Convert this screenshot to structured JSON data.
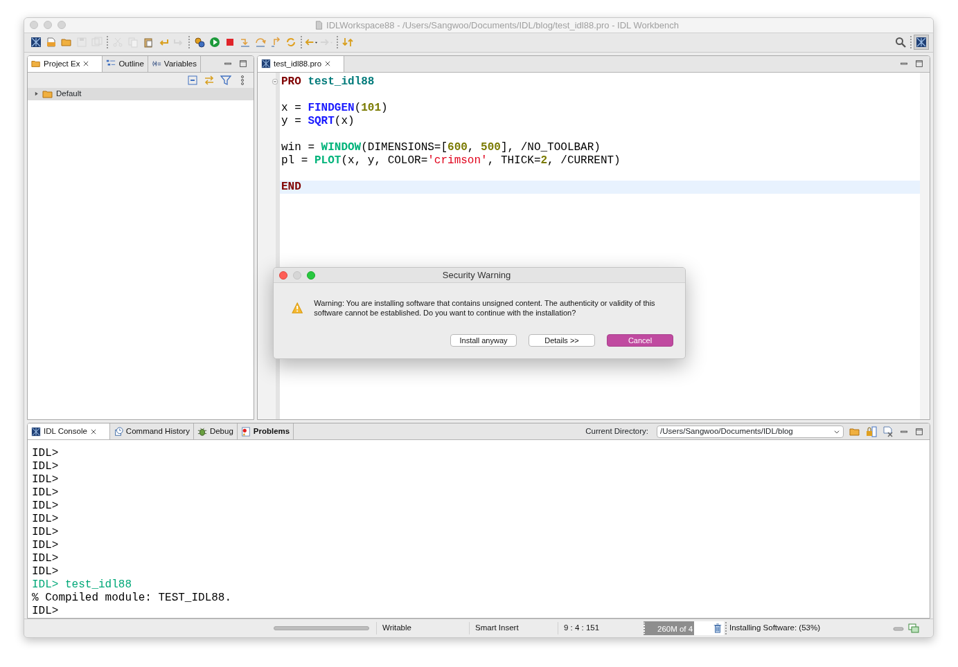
{
  "window": {
    "title": "IDLWorkspace88 - /Users/Sangwoo/Documents/IDL/blog/test_idl88.pro - IDL Workbench"
  },
  "toolbar": [
    {
      "kind": "idl",
      "disabled": false
    },
    {
      "kind": "new",
      "disabled": false
    },
    {
      "kind": "open",
      "disabled": false
    },
    {
      "kind": "save",
      "disabled": true
    },
    {
      "kind": "saveall",
      "disabled": true
    },
    {
      "kind": "separator"
    },
    {
      "kind": "cut",
      "disabled": true
    },
    {
      "kind": "copy",
      "disabled": true
    },
    {
      "kind": "paste",
      "disabled": false
    },
    {
      "kind": "undo",
      "disabled": false
    },
    {
      "kind": "redo",
      "disabled": true
    },
    {
      "kind": "separator"
    },
    {
      "kind": "compile",
      "disabled": false
    },
    {
      "kind": "run",
      "disabled": false
    },
    {
      "kind": "stop",
      "disabled": false
    },
    {
      "kind": "stepinto",
      "disabled": false
    },
    {
      "kind": "stepover",
      "disabled": false
    },
    {
      "kind": "stepreturn",
      "disabled": false
    },
    {
      "kind": "reset",
      "disabled": false
    },
    {
      "kind": "separator"
    },
    {
      "kind": "back",
      "disabled": false
    },
    {
      "kind": "forward",
      "disabled": true
    },
    {
      "kind": "separator"
    },
    {
      "kind": "annotation",
      "disabled": false
    }
  ],
  "left_panel": {
    "tabs": [
      {
        "label": "Project Ex",
        "selected": true,
        "closable": true
      },
      {
        "label": "Outline",
        "selected": false
      },
      {
        "label": "Variables",
        "selected": false
      }
    ],
    "tree": [
      {
        "label": "Default",
        "expanded": false,
        "selected": true
      }
    ]
  },
  "editor": {
    "tabs": [
      {
        "label": "test_idl88.pro",
        "selected": true,
        "closable": true
      }
    ],
    "lines": [
      {
        "current": false,
        "foldable": true,
        "expanded": true,
        "tokens": [
          {
            "text": "PRO",
            "kind": "keyword"
          },
          {
            "text": " test_idl88",
            "kind": "name"
          }
        ]
      },
      {
        "current": false
      },
      {
        "current": false,
        "tokens": [
          {
            "text": "x = ",
            "kind": "plain"
          },
          {
            "text": "FINDGEN",
            "kind": "function"
          },
          {
            "text": "(",
            "kind": "plain"
          },
          {
            "text": "101",
            "kind": "number"
          },
          {
            "text": ")",
            "kind": "plain"
          }
        ]
      },
      {
        "current": false,
        "tokens": [
          {
            "text": "y = ",
            "kind": "plain"
          },
          {
            "text": "SQRT",
            "kind": "function"
          },
          {
            "text": "(x)",
            "kind": "plain"
          }
        ]
      },
      {
        "current": false
      },
      {
        "current": false,
        "tokens": [
          {
            "text": "win = ",
            "kind": "plain"
          },
          {
            "text": "WINDOW",
            "kind": "graphics"
          },
          {
            "text": "(DIMENSIONS=[",
            "kind": "plain"
          },
          {
            "text": "600",
            "kind": "number"
          },
          {
            "text": ", ",
            "kind": "plain"
          },
          {
            "text": "500",
            "kind": "number"
          },
          {
            "text": "], /NO_TOOLBAR)",
            "kind": "plain"
          }
        ]
      },
      {
        "current": false,
        "tokens": [
          {
            "text": "pl = ",
            "kind": "plain"
          },
          {
            "text": "PLOT",
            "kind": "graphics"
          },
          {
            "text": "(x, y, COLOR=",
            "kind": "plain"
          },
          {
            "text": "'crimson'",
            "kind": "string"
          },
          {
            "text": ", THICK=",
            "kind": "plain"
          },
          {
            "text": "2",
            "kind": "number"
          },
          {
            "text": ", /CURRENT)",
            "kind": "plain"
          }
        ]
      },
      {
        "current": false
      },
      {
        "current": true,
        "tokens": [
          {
            "text": "END",
            "kind": "keyword"
          }
        ]
      }
    ]
  },
  "dialog": {
    "title": "Security Warning",
    "message": "Warning: You are installing software that contains unsigned content. The authenticity or validity of this software cannot be established. Do you want to continue with the installation?",
    "buttons": [
      {
        "label": "Install anyway",
        "default": false
      },
      {
        "label": "Details >>",
        "default": false
      },
      {
        "label": "Cancel",
        "default": true
      }
    ]
  },
  "console": {
    "tabs": [
      {
        "label": "IDL Console",
        "selected": true,
        "closable": true,
        "attention": false
      },
      {
        "label": "Command History",
        "selected": false,
        "attention": false
      },
      {
        "label": "Debug",
        "selected": false,
        "attention": false
      },
      {
        "label": "Problems",
        "selected": false,
        "attention": true
      }
    ],
    "directory_label": "Current Directory:",
    "directory": "/Users/Sangwoo/Documents/IDL/blog",
    "lines": [
      {
        "kind": "prompt",
        "text": "IDL>"
      },
      {
        "kind": "prompt",
        "text": "IDL>"
      },
      {
        "kind": "prompt",
        "text": "IDL>"
      },
      {
        "kind": "prompt",
        "text": "IDL>"
      },
      {
        "kind": "prompt",
        "text": "IDL>"
      },
      {
        "kind": "prompt",
        "text": "IDL>"
      },
      {
        "kind": "prompt",
        "text": "IDL>"
      },
      {
        "kind": "prompt",
        "text": "IDL>"
      },
      {
        "kind": "prompt",
        "text": "IDL>"
      },
      {
        "kind": "prompt",
        "text": "IDL>"
      },
      {
        "kind": "input",
        "text": "IDL> test_idl88"
      },
      {
        "kind": "output",
        "text": "% Compiled module: TEST_IDL88."
      },
      {
        "kind": "prompt",
        "text": "IDL>"
      }
    ]
  },
  "status_bar": {
    "mode": "Writable",
    "insert": "Smart Insert",
    "position": "9 : 4 : 151",
    "heap": {
      "text": "260M of 4",
      "level": 0.62
    },
    "job": "Installing Software: (53%)"
  }
}
